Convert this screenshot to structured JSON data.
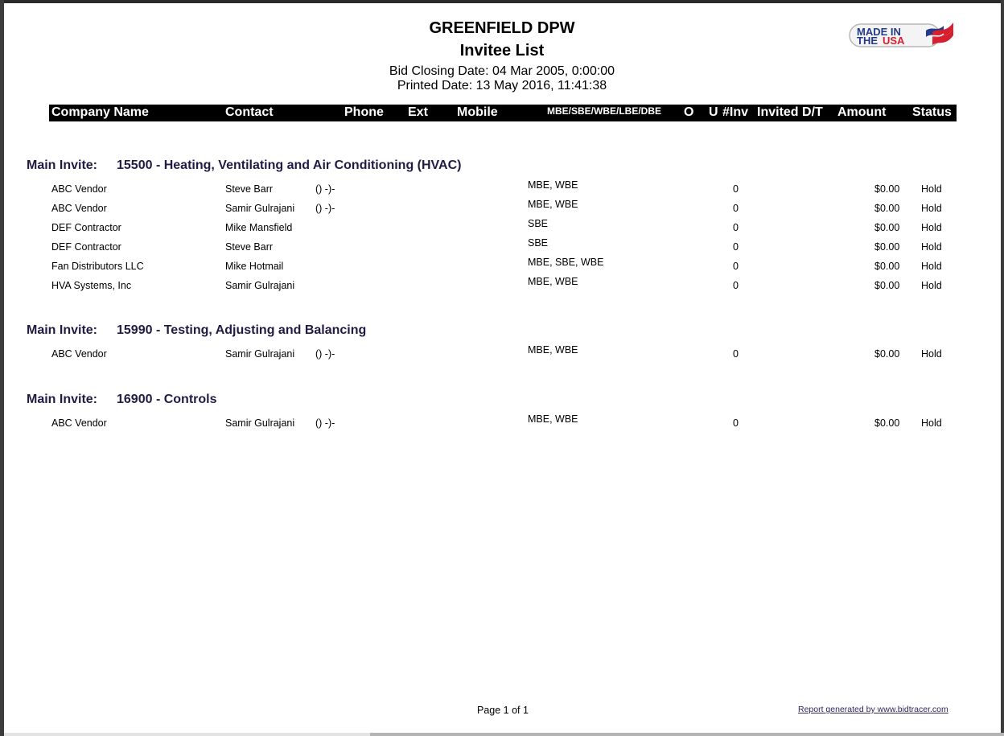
{
  "report": {
    "organization": "GREENFIELD DPW",
    "title": "Invitee List",
    "bid_closing": "Bid Closing Date: 04 Mar 2005, 0:00:00",
    "printed": "Printed Date: 13 May 2016, 11:41:38",
    "logo": {
      "line1": "MADE IN",
      "line2a": "THE",
      "line2b": "USA",
      "icon": "usa-flag-icon"
    }
  },
  "columns": {
    "company": "Company Name",
    "contact": "Contact",
    "phone": "Phone",
    "ext": "Ext",
    "mobile": "Mobile",
    "cert": "MBE/SBE/WBE/LBE/DBE",
    "o": "O",
    "u": "U",
    "inv": "#Inv",
    "invited": "Invited D/T",
    "amount": "Amount",
    "status": "Status"
  },
  "groups": [
    {
      "label": "Main Invite:",
      "name": "15500 - Heating, Ventilating and Air Conditioning (HVAC)",
      "rows": [
        {
          "company": "ABC Vendor",
          "contact": "Steve Barr",
          "phone": "() -)-",
          "cert": "MBE, WBE",
          "inv": "0",
          "amount": "$0.00",
          "status": "Hold"
        },
        {
          "company": "ABC Vendor",
          "contact": "Samir Gulrajani",
          "phone": "() -)-",
          "cert": "MBE, WBE",
          "inv": "0",
          "amount": "$0.00",
          "status": "Hold"
        },
        {
          "company": "DEF Contractor",
          "contact": "Mike Mansfield",
          "phone": "",
          "cert": "SBE",
          "inv": "0",
          "amount": "$0.00",
          "status": "Hold"
        },
        {
          "company": "DEF Contractor",
          "contact": "Steve Barr",
          "phone": "",
          "cert": "SBE",
          "inv": "0",
          "amount": "$0.00",
          "status": "Hold"
        },
        {
          "company": "Fan Distributors LLC",
          "contact": "Mike Hotmail",
          "phone": "",
          "cert": "MBE, SBE, WBE",
          "inv": "0",
          "amount": "$0.00",
          "status": "Hold"
        },
        {
          "company": "HVA Systems, Inc",
          "contact": "Samir Gulrajani",
          "phone": "",
          "cert": "MBE, WBE",
          "inv": "0",
          "amount": "$0.00",
          "status": "Hold"
        }
      ]
    },
    {
      "label": "Main Invite:",
      "name": "15990 - Testing, Adjusting and Balancing",
      "rows": [
        {
          "company": "ABC Vendor",
          "contact": "Samir Gulrajani",
          "phone": "() -)-",
          "cert": "MBE, WBE",
          "inv": "0",
          "amount": "$0.00",
          "status": "Hold"
        }
      ]
    },
    {
      "label": "Main Invite:",
      "name": "16900 - Controls",
      "rows": [
        {
          "company": "ABC Vendor",
          "contact": "Samir Gulrajani",
          "phone": "() -)-",
          "cert": "MBE, WBE",
          "inv": "0",
          "amount": "$0.00",
          "status": "Hold"
        }
      ]
    }
  ],
  "footer": {
    "page": "Page 1 of 1",
    "link": "Report generated by www.bidtracer.com"
  }
}
